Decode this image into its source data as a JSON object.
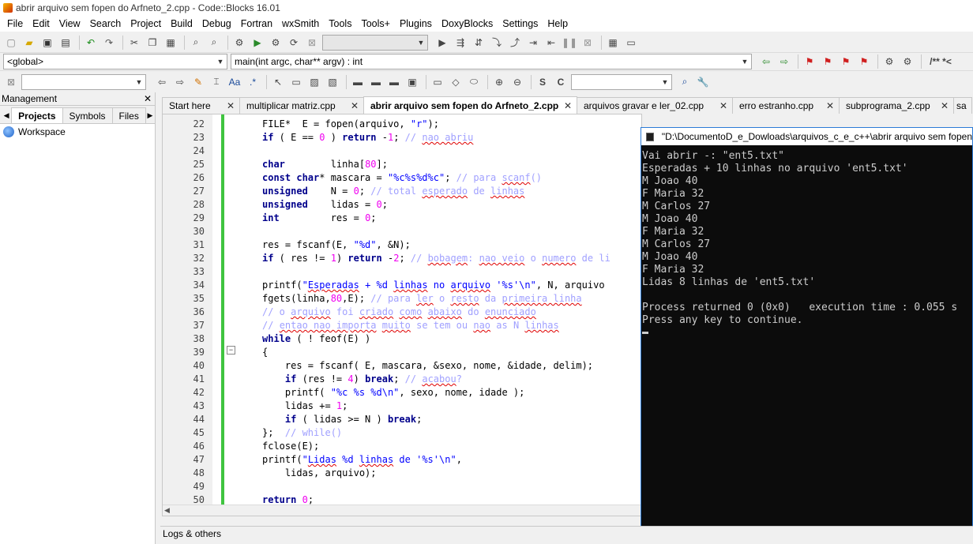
{
  "window": {
    "title": "abrir arquivo sem fopen do Arfneto_2.cpp - Code::Blocks 16.01"
  },
  "menu": [
    "File",
    "Edit",
    "View",
    "Search",
    "Project",
    "Build",
    "Debug",
    "Fortran",
    "wxSmith",
    "Tools",
    "Tools+",
    "Plugins",
    "DoxyBlocks",
    "Settings",
    "Help"
  ],
  "codebar": {
    "scope": "<global>",
    "function": "main(int argc, char** argv) : int",
    "doxy": "/** *<"
  },
  "management": {
    "title": "Management",
    "close": "✕",
    "tabs": [
      "Projects",
      "Symbols",
      "Files"
    ],
    "workspace": "Workspace"
  },
  "editor_tabs": [
    {
      "label": "Start here"
    },
    {
      "label": "multiplicar matriz.cpp"
    },
    {
      "label": "abrir arquivo sem fopen do Arfneto_2.cpp"
    },
    {
      "label": "arquivos gravar e ler_02.cpp"
    },
    {
      "label": "erro estranho.cpp"
    },
    {
      "label": "subprograma_2.cpp"
    },
    {
      "label": "sa"
    }
  ],
  "code_lines": [
    {
      "n": "22",
      "html": "FILE*  E = fopen(arquivo, <span class=\"st\">\"r\"</span>);"
    },
    {
      "n": "23",
      "html": "<span class=\"kw\">if</span> ( E == <span class=\"nm\">0</span> ) <span class=\"kw\">return</span> -<span class=\"nm\">1</span>; <span class=\"cm\">// <span class=\"sq\">nao abriu</span></span>"
    },
    {
      "n": "24",
      "html": ""
    },
    {
      "n": "25",
      "html": "<span class=\"kw\">char</span>        linha[<span class=\"nm\">80</span>];"
    },
    {
      "n": "26",
      "html": "<span class=\"kw\">const char</span>* mascara = <span class=\"st\">\"%c%s%d%c\"</span>; <span class=\"cm\">// para <span class=\"sq\">scanf</span>()</span>"
    },
    {
      "n": "27",
      "html": "<span class=\"kw\">unsigned</span>    N = <span class=\"nm\">0</span>; <span class=\"cm\">// total <span class=\"sq\">esperado</span> de <span class=\"sq\">linhas</span></span>"
    },
    {
      "n": "28",
      "html": "<span class=\"kw\">unsigned</span>    lidas = <span class=\"nm\">0</span>;"
    },
    {
      "n": "29",
      "html": "<span class=\"kw\">int</span>         res = <span class=\"nm\">0</span>;"
    },
    {
      "n": "30",
      "html": ""
    },
    {
      "n": "31",
      "html": "res = fscanf(E, <span class=\"st\">\"%d\"</span>, &amp;N);"
    },
    {
      "n": "32",
      "html": "<span class=\"kw\">if</span> ( res != <span class=\"nm\">1</span>) <span class=\"kw\">return</span> -<span class=\"nm\">2</span>; <span class=\"cm\">// <span class=\"sq\">bobagem</span>: <span class=\"sq\">nao veio</span> o <span class=\"sq\">numero</span> de li</span>"
    },
    {
      "n": "33",
      "html": ""
    },
    {
      "n": "34",
      "html": "printf(<span class=\"st\">\"<span class=\"sq\">Esperadas</span> + %d <span class=\"sq\">linhas</span> no <span class=\"sq\">arquivo</span> '%s'\\n\"</span>, N, arquivo"
    },
    {
      "n": "35",
      "html": "fgets(linha,<span class=\"nm\">80</span>,E); <span class=\"cm\">// para <span class=\"sq\">ler</span> o <span class=\"sq\">resto</span> da <span class=\"sq\">primeira linha</span></span>"
    },
    {
      "n": "36",
      "html": "<span class=\"cm\">// o <span class=\"sq\">arquivo</span> foi <span class=\"sq\">criado</span> <span class=\"sq\">como</span> <span class=\"sq\">abaixo</span> do <span class=\"sq\">enunciado</span></span>"
    },
    {
      "n": "37",
      "html": "<span class=\"cm\">// <span class=\"sq\">entao nao importa</span> <span class=\"sq\">muito</span> se tem ou <span class=\"sq\">nao</span> as N <span class=\"sq\">linhas</span></span>"
    },
    {
      "n": "38",
      "html": "<span class=\"kw\">while</span> ( ! feof(E) )"
    },
    {
      "n": "39",
      "html": "{"
    },
    {
      "n": "40",
      "html": "    res = fscanf( E, mascara, &amp;sexo, nome, &amp;idade, delim);"
    },
    {
      "n": "41",
      "html": "    <span class=\"kw\">if</span> (res != <span class=\"nm\">4</span>) <span class=\"kw\">break</span>; <span class=\"cm\">// <span class=\"sq\">acabou</span>?</span>"
    },
    {
      "n": "42",
      "html": "    printf( <span class=\"st\">\"%c %s %d\\n\"</span>, sexo, nome, idade );"
    },
    {
      "n": "43",
      "html": "    lidas += <span class=\"nm\">1</span>;"
    },
    {
      "n": "44",
      "html": "    <span class=\"kw\">if</span> ( lidas &gt;= N ) <span class=\"kw\">break</span>;"
    },
    {
      "n": "45",
      "html": "};  <span class=\"cm\">// while()</span>"
    },
    {
      "n": "46",
      "html": "fclose(E);"
    },
    {
      "n": "47",
      "html": "printf(<span class=\"st\">\"<span class=\"sq\">Lidas</span> %d <span class=\"sq\">linhas</span> de '%s'\\n\"</span>,"
    },
    {
      "n": "48",
      "html": "    lidas, arquivo);"
    },
    {
      "n": "49",
      "html": ""
    },
    {
      "n": "50",
      "html": "<span class=\"kw\">return</span> <span class=\"nm\">0</span>;"
    }
  ],
  "console": {
    "title": "\"D:\\DocumentoD_e_Dowloads\\arquivos_c_e_c++\\abrir arquivo sem fopen",
    "lines": [
      "Vai abrir -: \"ent5.txt\"",
      "Esperadas + 10 linhas no arquivo 'ent5.txt'",
      "M Joao 40",
      "F Maria 32",
      "M Carlos 27",
      "M Joao 40",
      "F Maria 32",
      "M Carlos 27",
      "M Joao 40",
      "F Maria 32",
      "Lidas 8 linhas de 'ent5.txt'",
      "",
      "Process returned 0 (0x0)   execution time : 0.055 s",
      "Press any key to continue."
    ]
  },
  "logs": {
    "label": "Logs & others"
  },
  "icons": {
    "new": "▫",
    "open": "📂",
    "save": "💾",
    "undo": "↶",
    "redo": "↷",
    "cut": "✂",
    "copy": "⧉",
    "paste": "📋",
    "find": "🔍",
    "replace": "⇄",
    "build": "⚙",
    "run": "▶",
    "buildrun": "⚑",
    "rebuild": "⟳",
    "abort": "⊠",
    "debug": "▶",
    "pause": "❚❚",
    "stop": "■",
    "prev": "⇦",
    "next": "⇨",
    "bookmark": "⚑"
  }
}
